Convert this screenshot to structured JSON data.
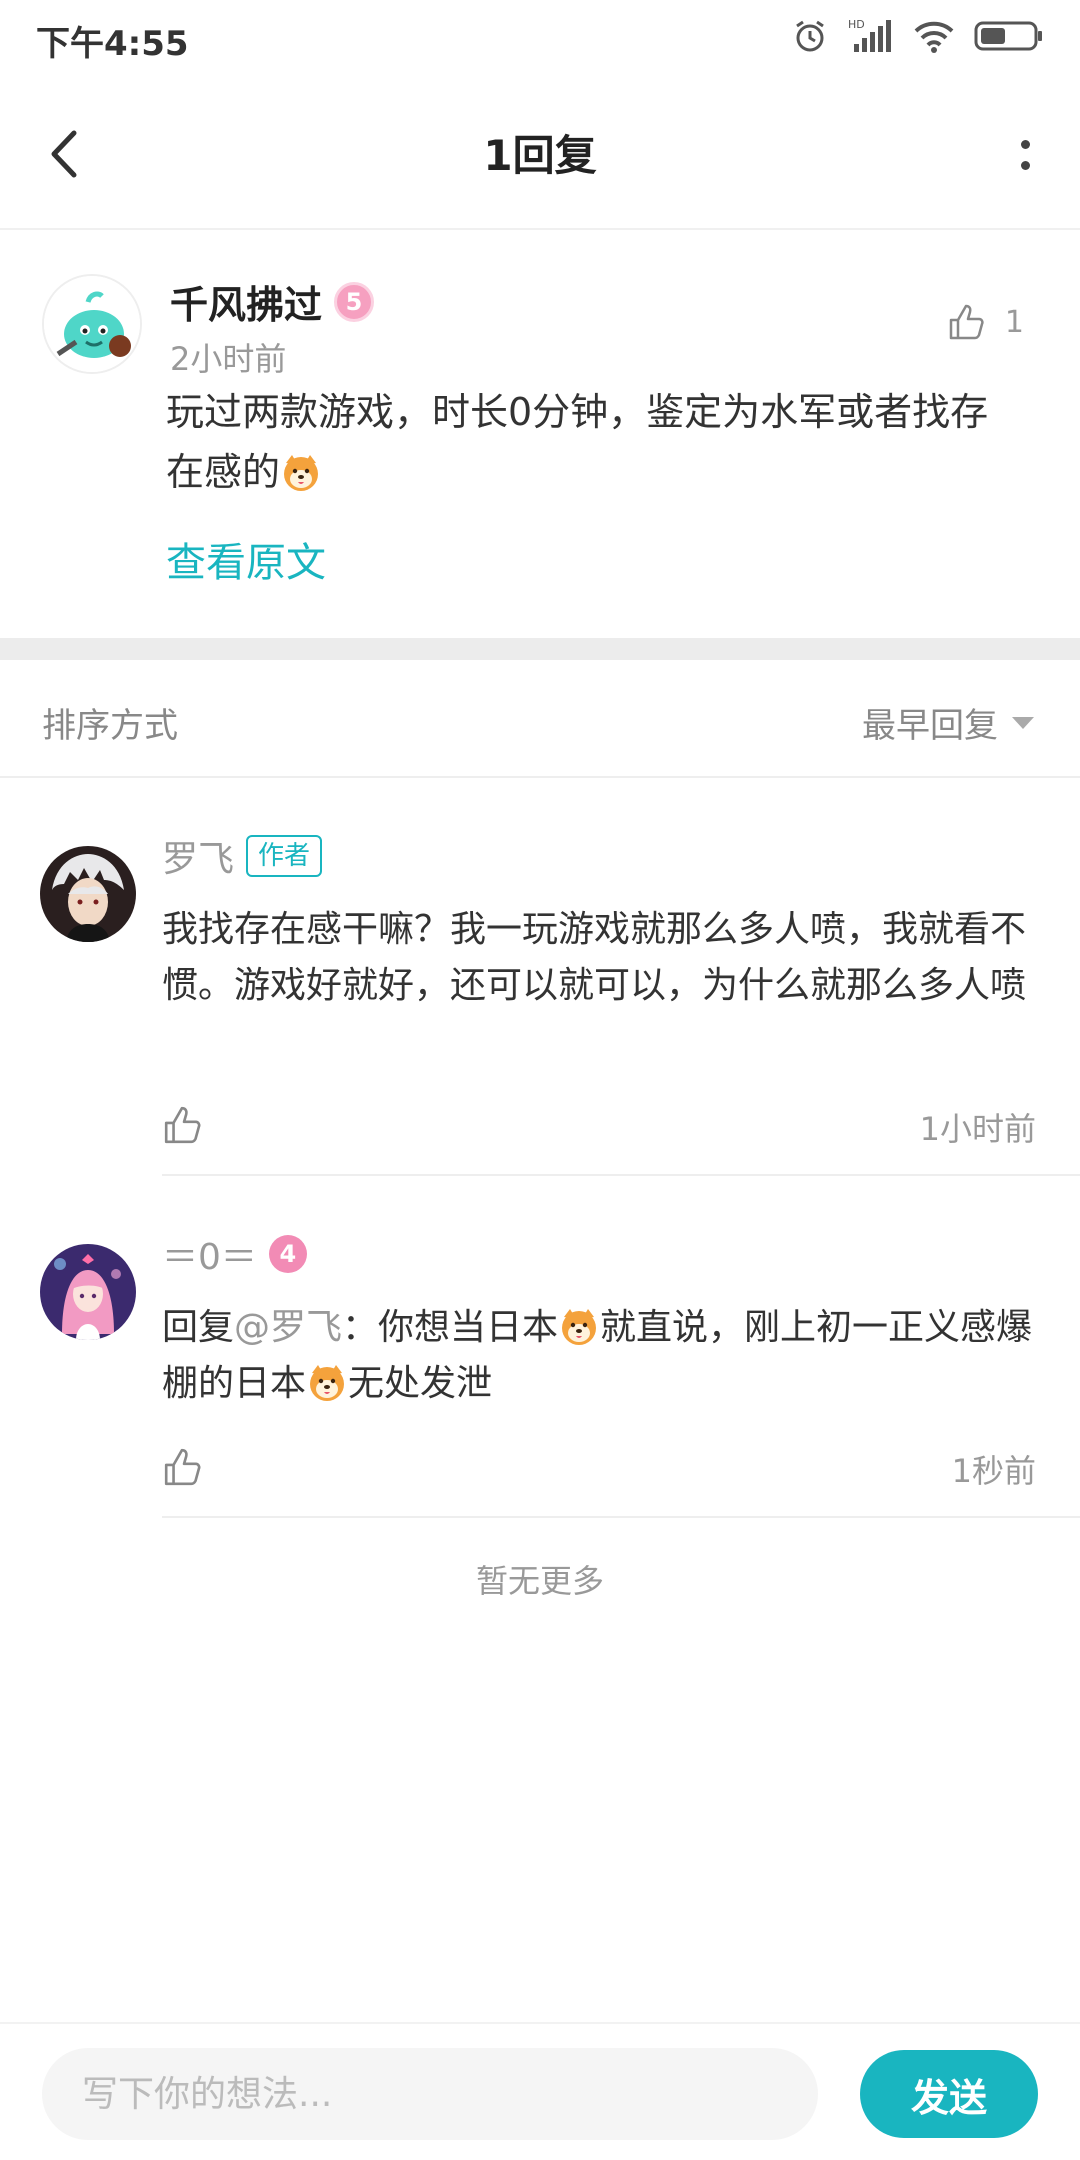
{
  "status_bar": {
    "time": "下午4:55",
    "icons": [
      "alarm-icon",
      "hd-signal-icon",
      "wifi-icon",
      "battery-icon"
    ]
  },
  "header": {
    "title": "1回复",
    "back_icon": "chevron-left-icon",
    "more_icon": "more-vertical-icon"
  },
  "post": {
    "author": "千风拂过",
    "level": "5",
    "time": "2小时前",
    "like_count": "1",
    "text": "玩过两款游戏，时长0分钟，鉴定为水军或者找存在感的",
    "emoji": "dog-face-emoji",
    "view_original": "查看原文"
  },
  "sort": {
    "label": "排序方式",
    "selected": "最早回复"
  },
  "replies": [
    {
      "author": "罗飞",
      "tag": "作者",
      "text": "我找存在感干嘛？我一玩游戏就那么多人喷，我就看不惯。游戏好就好，还可以就可以，为什么就那么多人喷",
      "time": "1小时前"
    },
    {
      "author": "＝0＝",
      "level": "4",
      "reply_prefix": "回复",
      "mention": "@罗飞",
      "text_a": "：你想当日本",
      "text_b": "就直说，刚上初一正义感爆棚的日本",
      "text_c": "无处发泄",
      "time": "1秒前"
    }
  ],
  "footer_note": "暂无更多",
  "bottom_bar": {
    "input_placeholder": "写下你的想法...",
    "send_label": "发送"
  },
  "colors": {
    "accent": "#19b5c0",
    "muted_text": "#999999",
    "body_text": "#333333"
  }
}
